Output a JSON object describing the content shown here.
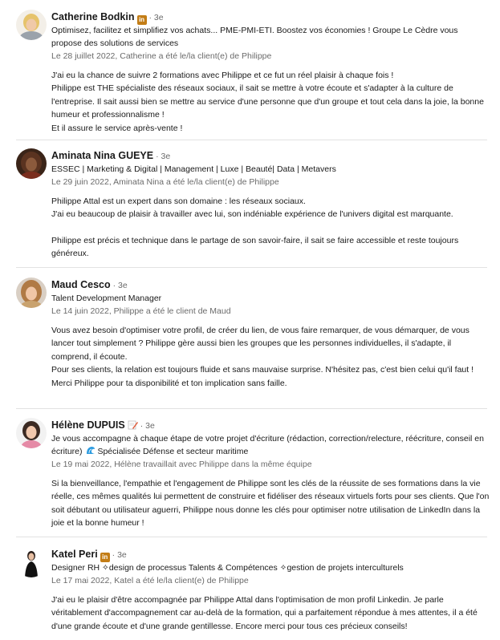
{
  "recommendations": [
    {
      "name": "Catherine Bodkin",
      "badge": "in",
      "degree": "· 3e",
      "headline": "Optimisez, facilitez et simplifiez vos achats... PME-PMI-ETI. Boostez vos économies ! Groupe Le Cèdre vous propose des solutions de services",
      "meta": "Le 28 juillet 2022, Catherine a été le/la client(e) de Philippe",
      "paragraphs": [
        "J'ai eu la chance de suivre 2 formations avec Philippe et ce fut un réel plaisir à chaque fois !",
        "Philippe est THE spécialiste des réseaux sociaux, il sait se mettre à votre écoute et s'adapter à la culture de l'entreprise. Il sait aussi bien se mettre au service d'une personne que d'un groupe et tout cela dans la joie, la bonne humeur et professionnalisme !",
        "Et il assure le service après-vente !"
      ]
    },
    {
      "name": "Aminata Nina GUEYE",
      "degree": "· 3e",
      "headline": "ESSEC | Marketing & Digital | Management | Luxe | Beauté| Data | Metavers",
      "meta": "Le 29 juin 2022, Aminata Nina a été le/la client(e) de Philippe",
      "paragraphs": [
        "Philippe Attal est un expert dans son domaine : les réseaux sociaux.",
        "J'ai eu beaucoup de plaisir à travailler avec lui, son indéniable expérience de l'univers digital est marquante.",
        "",
        "Philippe est précis et technique dans le partage de son savoir-faire, il sait se faire accessible et reste toujours généreux."
      ]
    },
    {
      "name": "Maud Cesco",
      "degree": "· 3e",
      "headline": "Talent Development Manager",
      "meta": "Le 14 juin 2022, Philippe a été le client de Maud",
      "paragraphs": [
        "Vous avez besoin d'optimiser votre profil, de créer du lien, de vous faire remarquer, de vous démarquer, de vous lancer tout simplement ? Philippe gère aussi bien les groupes que les personnes individuelles, il s'adapte, il comprend, il écoute.",
        "Pour ses clients, la relation est toujours fluide et sans mauvaise surprise. N'hésitez pas, c'est bien celui qu'il faut !",
        "Merci Philippe pour ta disponibilité et ton implication sans faille."
      ]
    },
    {
      "name": "Hélène DUPUIS",
      "icon": "pencil-emoji-icon",
      "degree": "· 3e",
      "headline_part1": "Je vous accompagne à chaque étape de votre projet d'écriture (rédaction, correction/relecture, réécriture, conseil en écriture)",
      "headline_icon": "wave-emoji-icon",
      "headline_part2": "Spécialisée Défense et secteur maritime",
      "meta": "Le 19 mai 2022, Hélène travaillait avec Philippe dans la même équipe",
      "paragraphs": [
        "Si la bienveillance, l'empathie et l'engagement de Philippe sont les clés de la réussite de ses formations dans la vie réelle, ces mêmes qualités lui permettent de construire et fidéliser des réseaux virtuels forts pour ses clients. Que l'on soit débutant ou utilisateur aguerri, Philippe nous donne les clés pour optimiser notre utilisation de LinkedIn dans la joie et la bonne humeur !"
      ]
    },
    {
      "name": "Katel Peri",
      "badge": "in",
      "degree": "· 3e",
      "headline": "Designer RH ✧design de processus Talents & Compétences ✧gestion de projets interculturels",
      "meta": "Le 17 mai 2022, Katel a été le/la client(e) de Philippe",
      "paragraphs": [
        "J'ai eu le plaisir d'être accompagnée par Philippe Attal dans l'optimisation de mon profil Linkedin. Je parle véritablement d'accompagnement car au-delà de la formation, qui a parfaitement répondue à mes attentes, il a été d'une grande écoute et d'une grande gentillesse. Encore merci pour tous ces précieux conseils!"
      ]
    }
  ],
  "colors": {
    "badge": "#c37d16",
    "divider": "#e2e2e2",
    "meta": "#666666"
  }
}
